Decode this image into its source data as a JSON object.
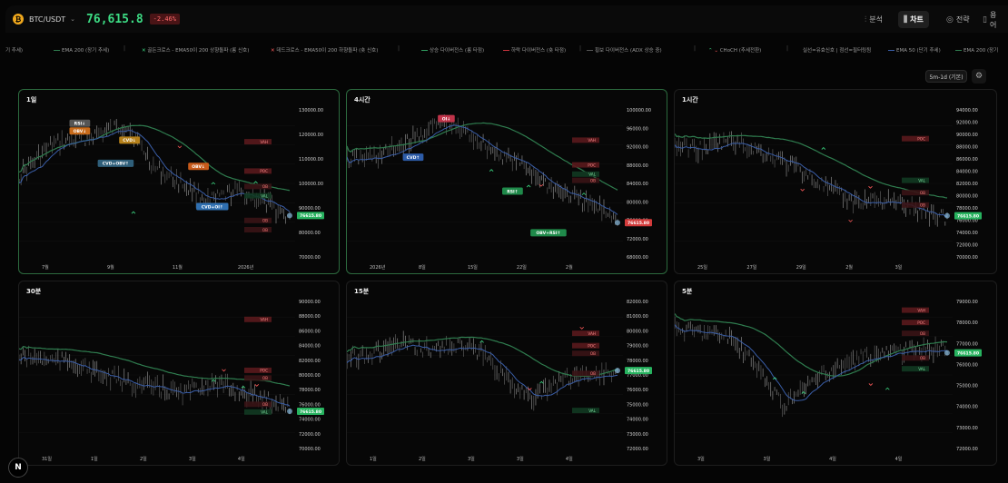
{
  "header": {
    "coin_glyph": "₿",
    "symbol": "BTC/USDT",
    "price": "76,615.8",
    "change": "-2.46%",
    "buttons": [
      {
        "icon": "chart-icon",
        "label": "분석",
        "left": 0
      },
      {
        "icon": "candles-icon",
        "label": "차트",
        "active": true
      },
      {
        "icon": "target-icon",
        "label": "전략"
      },
      {
        "icon": "book-icon",
        "label": "용어"
      }
    ]
  },
  "legend": [
    {
      "label": "기 추세)",
      "color": "",
      "kind": "text"
    },
    {
      "label": "EMA 200 (장기 추세)",
      "color": "#2f7d4f",
      "kind": "line"
    },
    {
      "label": "|",
      "kind": "sep"
    },
    {
      "label": "골든크로스 - EMA50이 200 상향돌파 (롱 신호)",
      "color": "#3ddc84",
      "kind": "x"
    },
    {
      "label": "데드크로스 - EMA50이 200 하향돌파 (숏 신호)",
      "color": "#ff5b5b",
      "kind": "x"
    },
    {
      "label": "|",
      "kind": "sep"
    },
    {
      "label": "상승 다이버전스 (롱 타점)",
      "color": "#2f9d5f",
      "kind": "line"
    },
    {
      "label": "하락 다이버전스 (숏 타점)",
      "color": "#c9343d",
      "kind": "line"
    },
    {
      "label": "|",
      "kind": "sep"
    },
    {
      "label": "횡보 다이버전스 (ADX 상승 중)",
      "color": "#555555",
      "kind": "line"
    },
    {
      "label": "|",
      "kind": "sep"
    },
    {
      "label": "CHoCH (추세전환)",
      "color": "#3ddc84",
      "kind": "choch"
    },
    {
      "label": "|",
      "kind": "sep"
    },
    {
      "label": "실선=유효신호 | 점선=필터링됨",
      "color": "",
      "kind": "text"
    },
    {
      "label": "EMA 50 (단기 추세)",
      "color": "#3a5ea8",
      "kind": "line"
    },
    {
      "label": "EMA 200 (장기",
      "color": "#2f7d4f",
      "kind": "line"
    }
  ],
  "toolbar": {
    "timeframe": "5m-1d (기본)",
    "gear": "gear-icon"
  },
  "panels": [
    {
      "id": "1d",
      "title": "1일",
      "highlight": true,
      "y_labels": [
        "130000.00",
        "120000.00",
        "110000.00",
        "100000.00",
        "90000.00",
        "80000.00",
        "70000.00"
      ],
      "x_labels": [
        "7월",
        "9월",
        "11월",
        "2026년"
      ],
      "current": "76615.80",
      "zones": [
        "VAH",
        "POC",
        "VAL",
        "OB",
        "OB",
        "OB"
      ],
      "signals": [
        "RSI↓",
        "OBV↓",
        "CVD↓",
        "CVD+OBV↑",
        "OBV↓",
        "CVD+OI↑"
      ]
    },
    {
      "id": "4h",
      "title": "4시간",
      "highlight": true,
      "y_labels": [
        "100000.00",
        "96000.00",
        "92000.00",
        "88000.00",
        "84000.00",
        "80000.00",
        "76000.00",
        "72000.00",
        "68000.00"
      ],
      "x_labels": [
        "2026년",
        "8일",
        "15일",
        "22일",
        "2월"
      ],
      "current": "76615.80",
      "zones": [
        "VAH",
        "POC",
        "VAL",
        "OB"
      ],
      "signals": [
        "OI↓",
        "CVD↑",
        "RSI↑",
        "OBV+RSI↑"
      ]
    },
    {
      "id": "1h",
      "title": "1시간",
      "highlight": false,
      "y_labels": [
        "94000.00",
        "92000.00",
        "90000.00",
        "88000.00",
        "86000.00",
        "84000.00",
        "82000.00",
        "80000.00",
        "78000.00",
        "76000.00",
        "74000.00",
        "72000.00",
        "70000.00"
      ],
      "x_labels": [
        "25일",
        "27일",
        "29일",
        "2월",
        "3일"
      ],
      "current": "76615.80",
      "zones": [
        "POC",
        "VAL",
        "OB",
        "OB"
      ],
      "signals": []
    },
    {
      "id": "30m",
      "title": "30분",
      "highlight": false,
      "y_labels": [
        "90000.00",
        "88000.00",
        "86000.00",
        "84000.00",
        "82000.00",
        "80000.00",
        "78000.00",
        "76000.00",
        "74000.00",
        "72000.00",
        "70000.00"
      ],
      "x_labels": [
        "31일",
        "1일",
        "2일",
        "3일",
        "4일"
      ],
      "current": "76615.80",
      "zones": [
        "VAH",
        "POC",
        "OB",
        "OB",
        "VAL"
      ],
      "signals": []
    },
    {
      "id": "15m",
      "title": "15분",
      "highlight": false,
      "y_labels": [
        "82000.00",
        "81000.00",
        "80000.00",
        "79000.00",
        "78000.00",
        "77000.00",
        "76000.00",
        "75000.00",
        "74000.00",
        "73000.00",
        "72000.00"
      ],
      "x_labels": [
        "1일",
        "2일",
        "3일",
        "3일",
        "4일"
      ],
      "current": "76615.80",
      "zones": [
        "VAH",
        "POC",
        "OB",
        "OB",
        "VAL"
      ],
      "signals": []
    },
    {
      "id": "5m",
      "title": "5분",
      "highlight": false,
      "y_labels": [
        "79000.00",
        "78000.00",
        "77000.00",
        "76000.00",
        "75000.00",
        "74000.00",
        "73000.00",
        "72000.00"
      ],
      "x_labels": [
        "3일",
        "3일",
        "4일",
        "4일"
      ],
      "current": "76615.80",
      "zones": [
        "VAH",
        "POC",
        "OB",
        "OB",
        "VAL"
      ],
      "signals": []
    }
  ],
  "logo": "N"
}
